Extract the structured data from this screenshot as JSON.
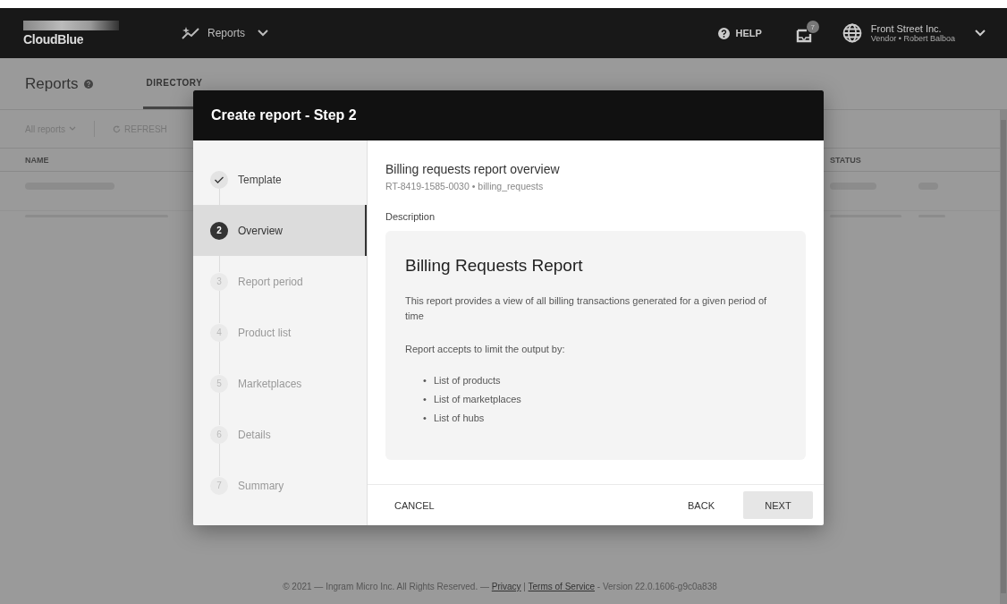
{
  "top_bar": {
    "logo": "CloudBlue",
    "nav": {
      "label": "Reports"
    },
    "help": "HELP",
    "notifications": {
      "count": "7"
    },
    "account": {
      "name": "Front Street Inc.",
      "role": "Vendor • Robert Balboa"
    }
  },
  "page_header": {
    "title": "Reports",
    "tabs": [
      {
        "label": "DIRECTORY",
        "selected": true
      }
    ]
  },
  "toolbar": {
    "filter": "All reports",
    "refresh": "REFRESH"
  },
  "table": {
    "columns": [
      "NAME",
      "STATUS"
    ]
  },
  "footer": {
    "copyright": "© 2021 — Ingram Micro Inc. All Rights Reserved. —",
    "links": [
      "Privacy",
      "Terms of Service"
    ],
    "separator": "|",
    "version": "- Version 22.0.1606-g9c0a838"
  },
  "dialog": {
    "title": "Create report - Step 2",
    "steps": [
      {
        "kind": "done",
        "label": "Template",
        "selected": false
      },
      {
        "kind": "current",
        "number": "2",
        "label": "Overview",
        "selected": true
      },
      {
        "kind": "pending",
        "number": "3",
        "label": "Report period",
        "selected": false
      },
      {
        "kind": "pending",
        "number": "4",
        "label": "Product list",
        "selected": false
      },
      {
        "kind": "pending",
        "number": "5",
        "label": "Marketplaces",
        "selected": false
      },
      {
        "kind": "pending",
        "number": "6",
        "label": "Details",
        "selected": false
      },
      {
        "kind": "pending",
        "number": "7",
        "label": "Summary",
        "selected": false
      }
    ],
    "heading": "Billing requests report overview",
    "subheading": "RT-8419-1585-0030 • billing_requests",
    "section_label": "Description",
    "card": {
      "title": "Billing Requests Report",
      "paragraphs": [
        "This report provides a view of all billing transactions generated for a given period of time",
        "Report accepts to limit the output by:"
      ],
      "marker": "•",
      "bullets": [
        "List of products",
        "List of marketplaces",
        "List of hubs"
      ]
    },
    "buttons": {
      "cancel": "CANCEL",
      "back": "BACK",
      "next": "NEXT"
    }
  }
}
